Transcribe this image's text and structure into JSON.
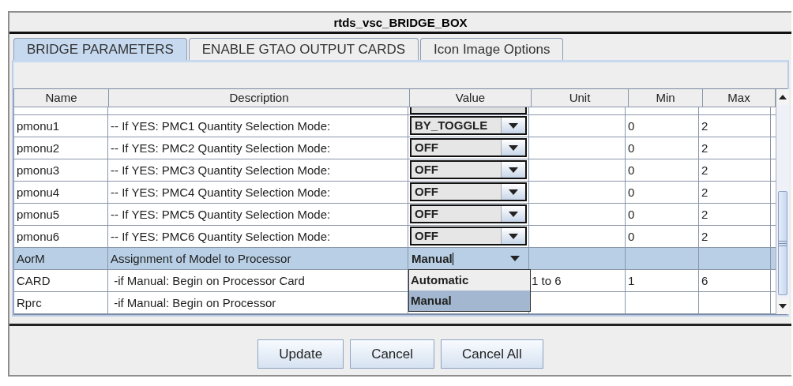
{
  "window": {
    "title": "rtds_vsc_BRIDGE_BOX"
  },
  "tabs": [
    {
      "label": "BRIDGE PARAMETERS",
      "selected": true
    },
    {
      "label": "ENABLE GTAO OUTPUT CARDS",
      "selected": false
    },
    {
      "label": "Icon Image Options",
      "selected": false
    }
  ],
  "table": {
    "columns": [
      "Name",
      "Description",
      "Value",
      "Unit",
      "Min",
      "Max"
    ],
    "rows": [
      {
        "name": "pmonu1",
        "description": "-- If YES: PMC1 Quantity Selection Mode:",
        "kind": "combo",
        "value": "BY_TOGGLE",
        "unit": "",
        "min": "0",
        "max": "2",
        "selected": false
      },
      {
        "name": "pmonu2",
        "description": "-- If YES: PMC2 Quantity Selection Mode:",
        "kind": "combo",
        "value": "OFF",
        "unit": "",
        "min": "0",
        "max": "2",
        "selected": false
      },
      {
        "name": "pmonu3",
        "description": "-- If YES: PMC3 Quantity Selection Mode:",
        "kind": "combo",
        "value": "OFF",
        "unit": "",
        "min": "0",
        "max": "2",
        "selected": false
      },
      {
        "name": "pmonu4",
        "description": "-- If YES: PMC4 Quantity Selection Mode:",
        "kind": "combo",
        "value": "OFF",
        "unit": "",
        "min": "0",
        "max": "2",
        "selected": false
      },
      {
        "name": "pmonu5",
        "description": "-- If YES: PMC5 Quantity Selection Mode:",
        "kind": "combo",
        "value": "OFF",
        "unit": "",
        "min": "0",
        "max": "2",
        "selected": false
      },
      {
        "name": "pmonu6",
        "description": "-- If YES: PMC6 Quantity Selection Mode:",
        "kind": "combo",
        "value": "OFF",
        "unit": "",
        "min": "0",
        "max": "2",
        "selected": false
      },
      {
        "name": "AorM",
        "description": "Assignment of Model to Processor",
        "kind": "editing",
        "value": "Manual",
        "unit": "",
        "min": "",
        "max": "",
        "selected": true
      },
      {
        "name": "CARD",
        "description": " -if Manual: Begin on Processor Card",
        "kind": "covered",
        "unit": "1 to 6",
        "min": "1",
        "max": "6",
        "selected": false
      },
      {
        "name": "Rprc",
        "description": " -if Manual: Begin on Processor",
        "kind": "covered",
        "unit": "",
        "min": "",
        "max": "",
        "selected": false
      }
    ]
  },
  "dropdown": {
    "options": [
      {
        "label": "Automatic",
        "selected": false
      },
      {
        "label": "Manual",
        "selected": true
      }
    ]
  },
  "buttons": [
    "Update",
    "Cancel",
    "Cancel All"
  ]
}
